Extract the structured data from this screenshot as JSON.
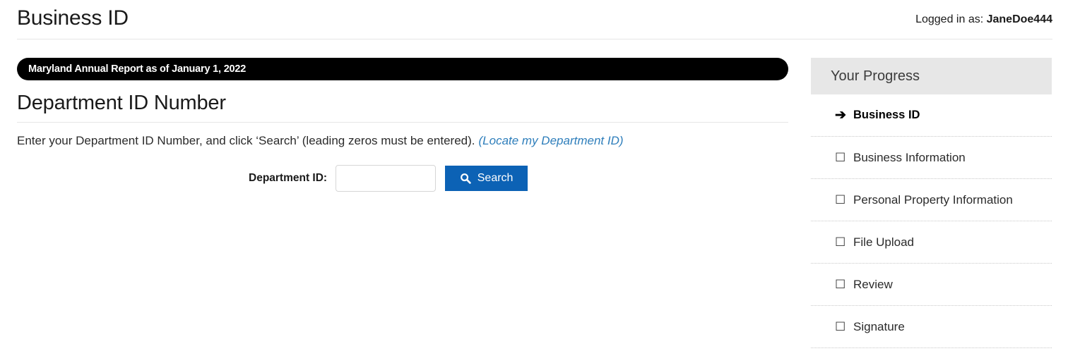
{
  "header": {
    "title": "Business ID",
    "logged_in_prefix": "Logged in as:",
    "username": "JaneDoe444"
  },
  "banner": {
    "text": "Maryland Annual Report as of January 1, 2022",
    "background": "#000000",
    "text_color": "#ffffff"
  },
  "main": {
    "heading": "Department ID Number",
    "instructions": "Enter your Department ID Number, and click ‘Search’ (leading zeros must be entered).",
    "locate_link": "(Locate my Department ID)",
    "link_color": "#2e7ebb",
    "form": {
      "label": "Department ID:",
      "input_value": "",
      "input_placeholder": "",
      "search_label": "Search",
      "search_icon": "search-icon",
      "search_button_color": "#0c62b5"
    }
  },
  "sidebar": {
    "title": "Your Progress",
    "header_background": "#e7e7e7",
    "items": [
      {
        "label": "Business ID",
        "marker": "➔",
        "marker_name": "arrow-right-icon",
        "active": true
      },
      {
        "label": "Business Information",
        "marker": "☐",
        "marker_name": "checkbox-icon",
        "active": false
      },
      {
        "label": "Personal Property Information",
        "marker": "☐",
        "marker_name": "checkbox-icon",
        "active": false
      },
      {
        "label": "File Upload",
        "marker": "☐",
        "marker_name": "checkbox-icon",
        "active": false
      },
      {
        "label": "Review",
        "marker": "☐",
        "marker_name": "checkbox-icon",
        "active": false
      },
      {
        "label": "Signature",
        "marker": "☐",
        "marker_name": "checkbox-icon",
        "active": false
      }
    ]
  }
}
